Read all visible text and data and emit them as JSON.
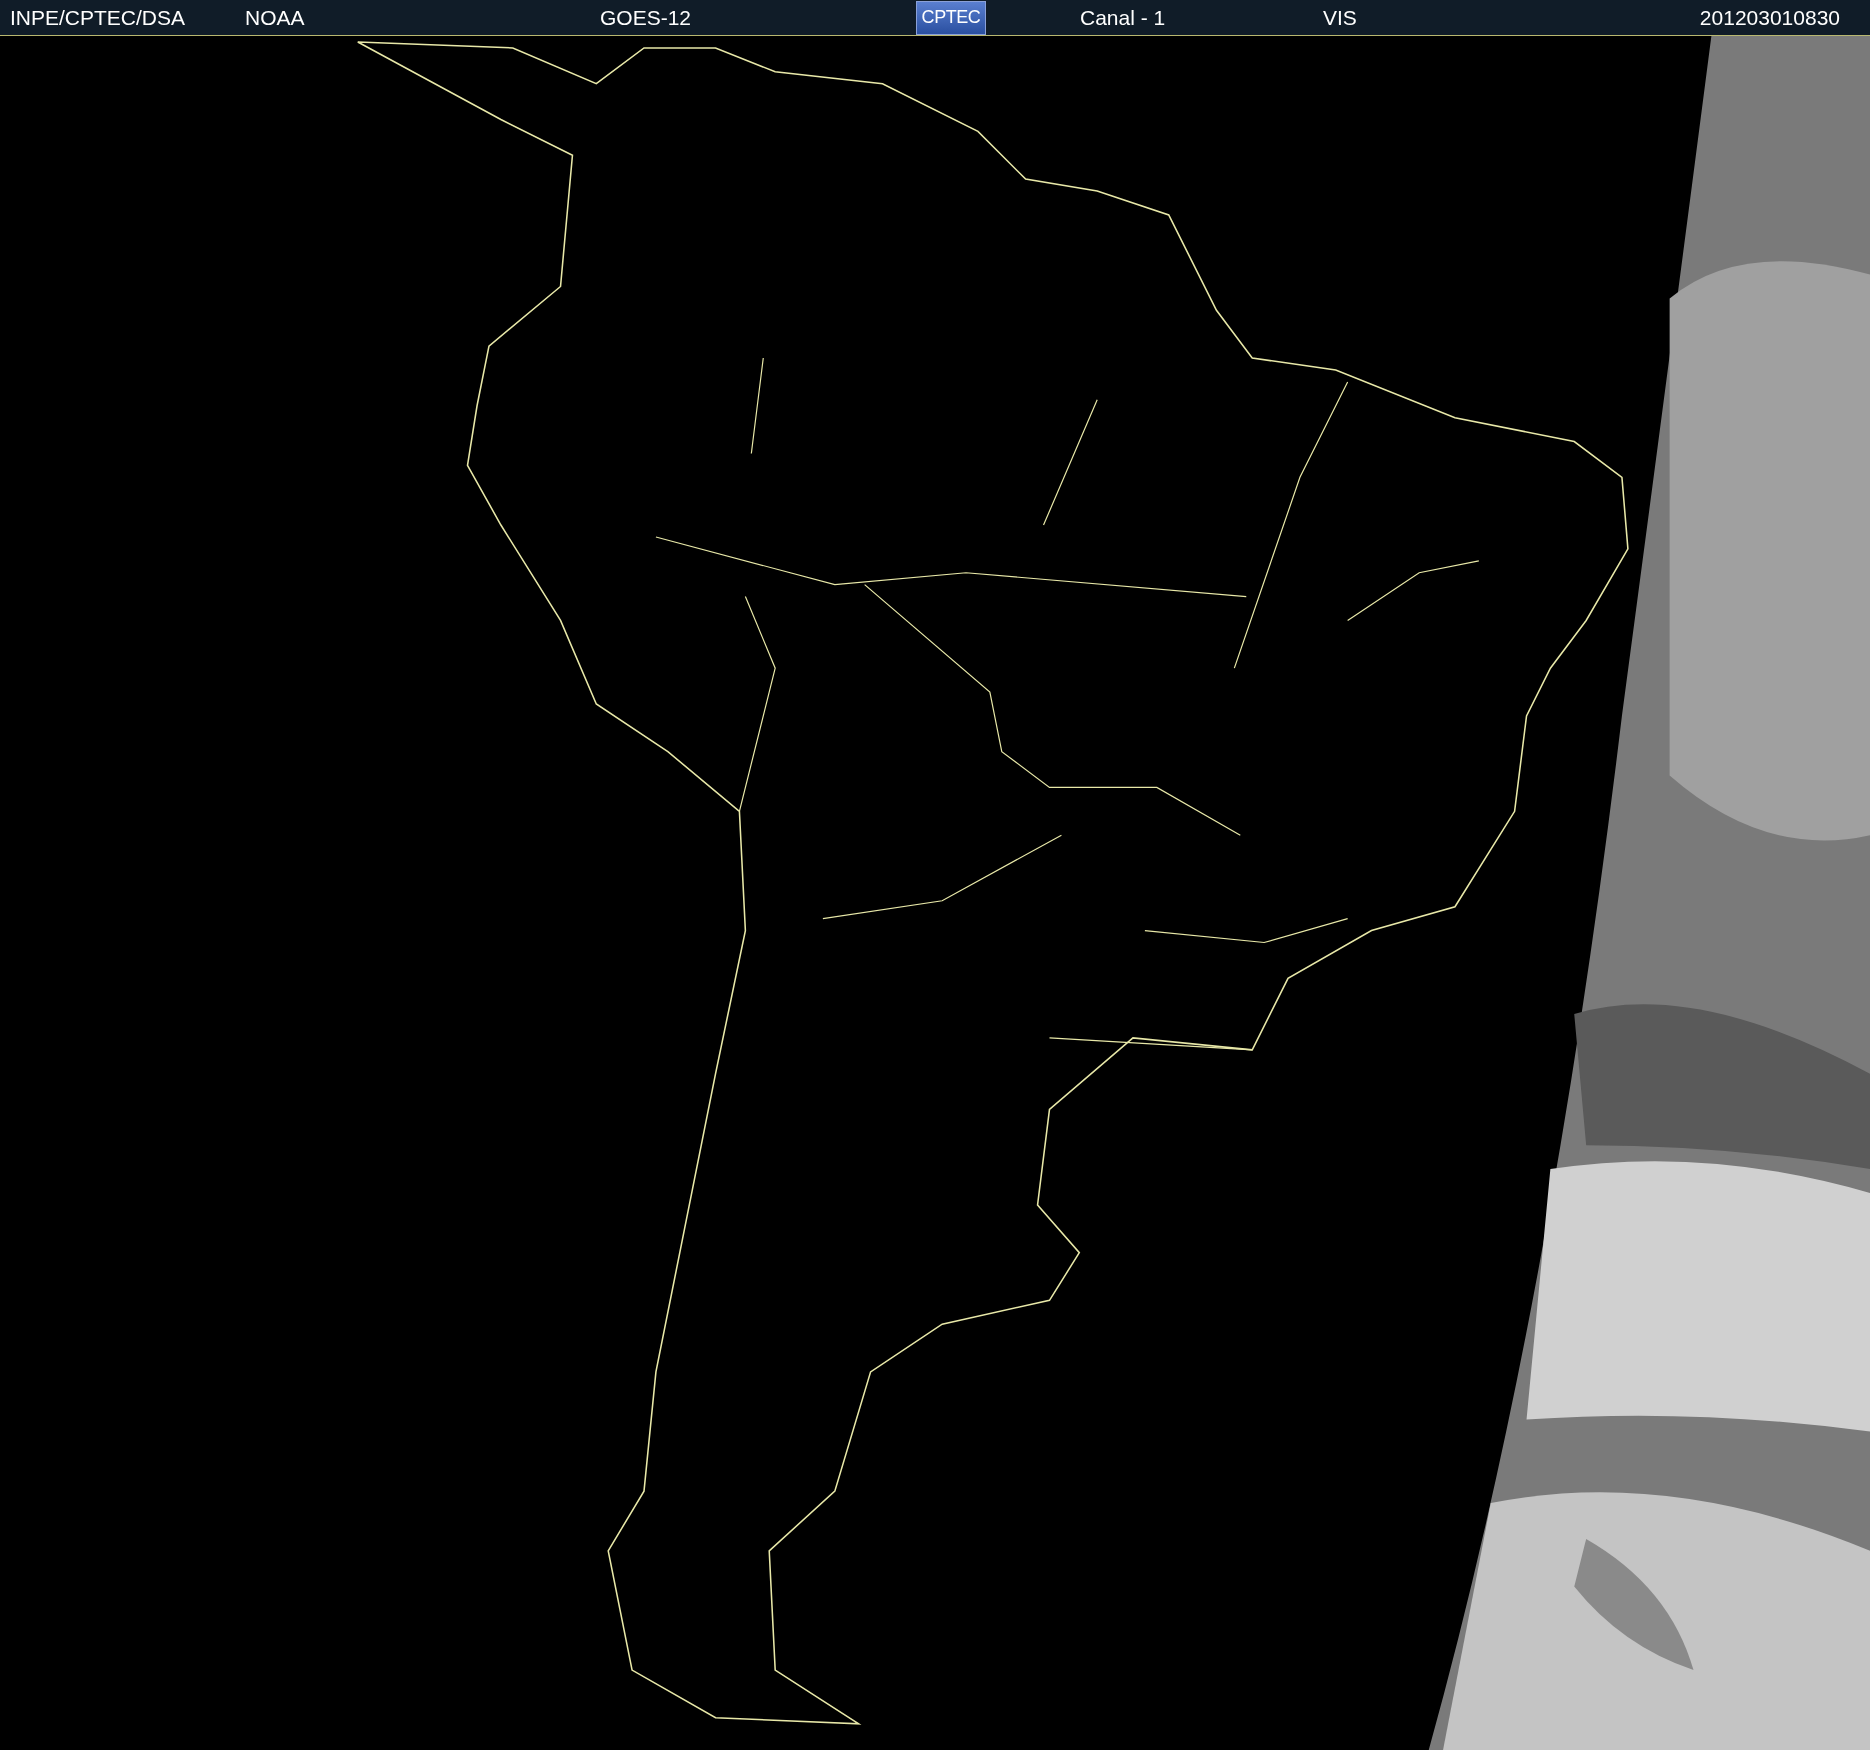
{
  "header": {
    "source": "INPE/CPTEC/DSA",
    "agency": "NOAA",
    "satellite": "GOES-12",
    "logo": "CPTEC",
    "channel": "Canal - 1",
    "band": "VIS",
    "timestamp": "201203010830"
  }
}
